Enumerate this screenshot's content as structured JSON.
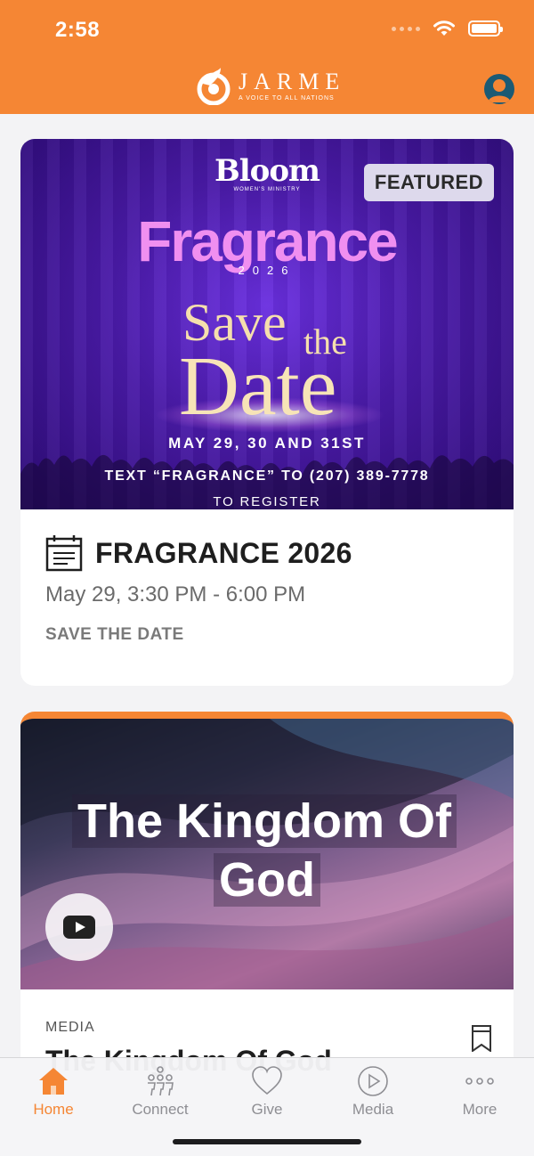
{
  "status_bar": {
    "time": "2:58"
  },
  "header": {
    "brand_name": "JARME",
    "brand_tagline": "A VOICE TO ALL NATIONS"
  },
  "featured_card": {
    "badge": "FEATURED",
    "banner": {
      "ministry_logo": "Bloom",
      "ministry_subtitle": "WOMEN'S MINISTRY",
      "event_name": "Fragrance",
      "event_year": "2026",
      "save_line_1": "Save",
      "save_line_2": "the",
      "save_line_3": "Date",
      "dates": "MAY 29, 30 AND 31ST",
      "text_line": "TEXT “FRAGRANCE” TO (207) 389-7778",
      "register_line": "TO REGISTER"
    },
    "title": "FRAGRANCE 2026",
    "time": "May 29, 3:30 PM - 6:00 PM",
    "label": "SAVE THE DATE",
    "icon": "calendar-icon"
  },
  "media_card": {
    "banner_title": "The Kingdom Of God",
    "type": "MEDIA",
    "title": "The Kingdom Of God",
    "icons": [
      "play-icon",
      "bookmark-icon"
    ]
  },
  "tabs": [
    {
      "label": "Home",
      "icon": "home-icon",
      "active": true
    },
    {
      "label": "Connect",
      "icon": "connect-icon",
      "active": false
    },
    {
      "label": "Give",
      "icon": "heart-icon",
      "active": false
    },
    {
      "label": "Media",
      "icon": "play-circle-icon",
      "active": false
    },
    {
      "label": "More",
      "icon": "more-icon",
      "active": false
    }
  ],
  "colors": {
    "accent": "#f58634",
    "banner_purple": "#4a1aa8",
    "profile": "#1b5a74"
  }
}
